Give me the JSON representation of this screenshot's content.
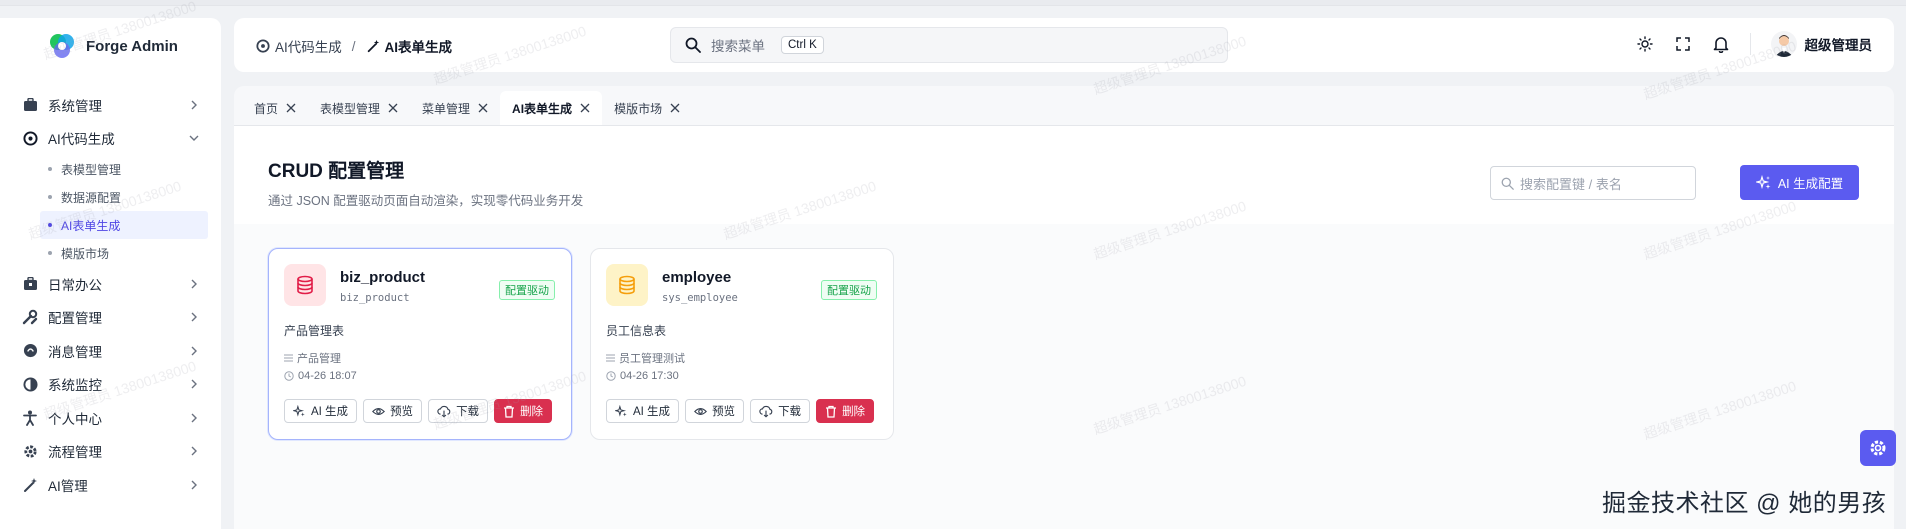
{
  "app": {
    "title": "Forge Admin"
  },
  "sidebar": {
    "items": [
      {
        "label": "系统管理",
        "icon": "briefcase-icon"
      },
      {
        "label": "AI代码生成",
        "icon": "openai-icon",
        "expanded": true,
        "children": [
          {
            "label": "表模型管理"
          },
          {
            "label": "数据源配置"
          },
          {
            "label": "AI表单生成",
            "active": true
          },
          {
            "label": "模版市场"
          }
        ]
      },
      {
        "label": "日常办公",
        "icon": "briefcase-lock-icon"
      },
      {
        "label": "配置管理",
        "icon": "tools-icon"
      },
      {
        "label": "消息管理",
        "icon": "message-icon"
      },
      {
        "label": "系统监控",
        "icon": "monitor-icon"
      },
      {
        "label": "个人中心",
        "icon": "person-icon"
      },
      {
        "label": "流程管理",
        "icon": "gear-icon"
      },
      {
        "label": "AI管理",
        "icon": "magic-wand-icon"
      }
    ]
  },
  "header": {
    "breadcrumb": [
      {
        "label": "AI代码生成",
        "icon": "openai-icon"
      },
      {
        "label": "AI表单生成",
        "icon": "magic-wand-icon"
      }
    ],
    "breadcrumb_sep": "/",
    "search_placeholder": "搜索菜单",
    "search_shortcut": "Ctrl K",
    "user_name": "超级管理员"
  },
  "tabs": [
    {
      "label": "首页"
    },
    {
      "label": "表模型管理"
    },
    {
      "label": "菜单管理"
    },
    {
      "label": "AI表单生成",
      "active": true
    },
    {
      "label": "模版市场"
    }
  ],
  "page": {
    "title": "CRUD 配置管理",
    "subtitle": "通过 JSON 配置驱动页面自动渲染，实现零代码业务开发",
    "search_placeholder": "搜索配置键 / 表名",
    "ai_button": "AI 生成配置"
  },
  "cards": [
    {
      "name": "biz_product",
      "table": "biz_product",
      "badge": "配置驱动",
      "desc": "产品管理表",
      "menu": "产品管理",
      "time": "04-26 18:07",
      "icon_color": "#e11d48",
      "icon_bg": "#ffe4e6"
    },
    {
      "name": "employee",
      "table": "sys_employee",
      "badge": "配置驱动",
      "desc": "员工信息表",
      "menu": "员工管理测试",
      "time": "04-26 17:30",
      "icon_color": "#f59e0b",
      "icon_bg": "#fef3c7"
    }
  ],
  "card_actions": {
    "ai": "AI 生成",
    "preview": "预览",
    "download": "下载",
    "delete": "删除"
  },
  "watermark": "超级管理员 13800138000",
  "corner_text": "掘金技术社区 @ 她的男孩",
  "colors": {
    "accent": "#5b5bf0",
    "danger": "#d9304f",
    "success": "#16a34a"
  }
}
